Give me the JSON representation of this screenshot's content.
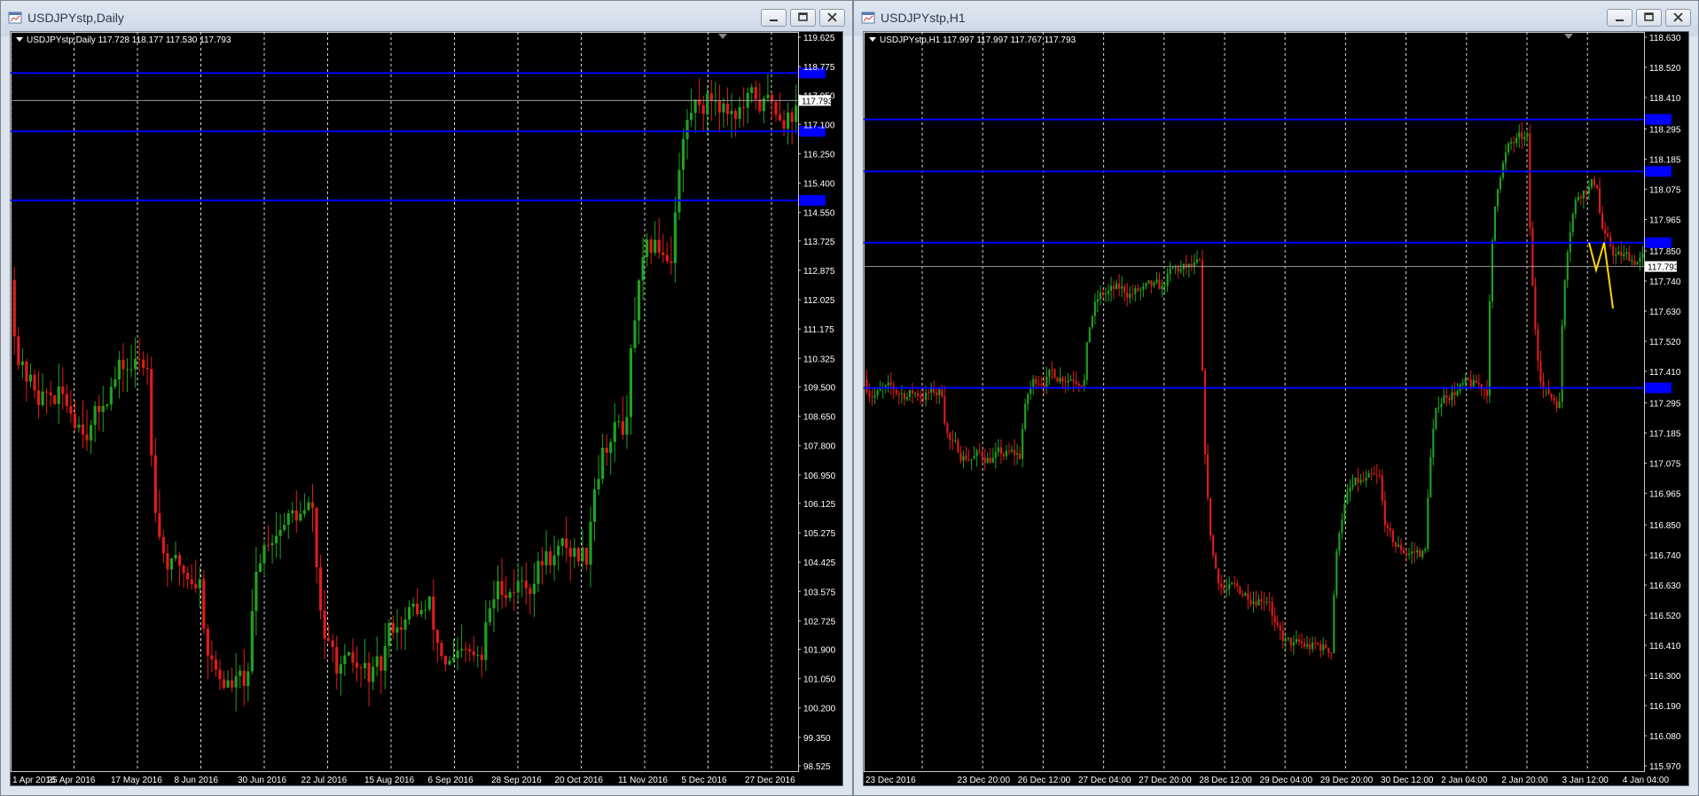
{
  "left_window": {
    "title": "USDJPYstp,Daily",
    "header": "USDJPYstp,Daily  117.728 118.177 117.530 117.793",
    "buttons": [
      "minimize",
      "restore",
      "close"
    ],
    "y_ticks": [
      "119.625",
      "118.775",
      "117.950",
      "117.100",
      "116.250",
      "115.400",
      "114.550",
      "113.725",
      "112.875",
      "112.025",
      "111.175",
      "110.325",
      "109.500",
      "108.650",
      "107.800",
      "106.950",
      "106.125",
      "105.275",
      "104.425",
      "103.575",
      "102.725",
      "101.900",
      "101.050",
      "100.200",
      "99.350",
      "98.525"
    ],
    "x_ticks": [
      "1 Apr 2016",
      "25 Apr 2016",
      "17 May 2016",
      "8 Jun 2016",
      "30 Jun 2016",
      "22 Jul 2016",
      "15 Aug 2016",
      "6 Sep 2016",
      "28 Sep 2016",
      "20 Oct 2016",
      "11 Nov 2016",
      "5 Dec 2016",
      "27 Dec 2016"
    ],
    "price_label": "117.793",
    "hlines": [
      118.59,
      116.9,
      114.9
    ]
  },
  "right_window": {
    "title": "USDJPYstp,H1",
    "header": "USDJPYstp,H1  117.997 117.997 117.767 117.793",
    "buttons": [
      "minimize",
      "restore",
      "close"
    ],
    "y_ticks": [
      "118.630",
      "118.520",
      "118.410",
      "118.295",
      "118.185",
      "118.075",
      "117.965",
      "117.850",
      "117.740",
      "117.630",
      "117.520",
      "117.410",
      "117.295",
      "117.185",
      "117.075",
      "116.965",
      "116.850",
      "116.740",
      "116.630",
      "116.520",
      "116.410",
      "116.300",
      "116.190",
      "116.080",
      "115.970"
    ],
    "x_ticks": [
      "23 Dec 2016",
      "23 Dec 20:00",
      "26 Dec 12:00",
      "27 Dec 04:00",
      "27 Dec 20:00",
      "28 Dec 12:00",
      "29 Dec 04:00",
      "29 Dec 20:00",
      "30 Dec 12:00",
      "2 Jan 04:00",
      "2 Jan 20:00",
      "3 Jan 12:00",
      "4 Jan 04:00"
    ],
    "price_label": "117.793",
    "hlines": [
      118.33,
      118.14,
      117.88,
      117.35
    ]
  },
  "colors": {
    "background": "#000000",
    "bull": "#1fa21f",
    "bear": "#e01b1b",
    "level_line": "#0000ff",
    "price_line": "#9a9a9a",
    "forecast": "#ffd700",
    "grid": "#ffffff"
  }
}
